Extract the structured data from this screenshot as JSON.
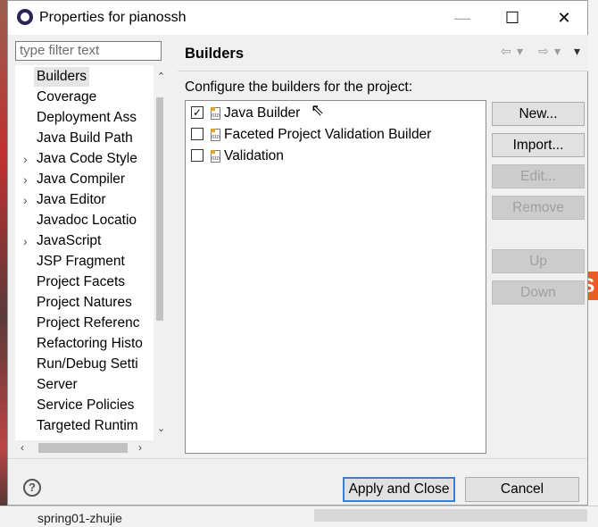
{
  "window": {
    "title": "Properties for pianossh"
  },
  "filter": {
    "placeholder": "type filter text"
  },
  "tree": {
    "items": [
      {
        "label": "Builders",
        "expandable": false,
        "selected": true
      },
      {
        "label": "Coverage",
        "expandable": false
      },
      {
        "label": "Deployment Ass",
        "expandable": false
      },
      {
        "label": "Java Build Path",
        "expandable": false
      },
      {
        "label": "Java Code Style",
        "expandable": true
      },
      {
        "label": "Java Compiler",
        "expandable": true
      },
      {
        "label": "Java Editor",
        "expandable": true
      },
      {
        "label": "Javadoc Locatio",
        "expandable": false
      },
      {
        "label": "JavaScript",
        "expandable": true
      },
      {
        "label": "JSP Fragment",
        "expandable": false
      },
      {
        "label": "Project Facets",
        "expandable": false
      },
      {
        "label": "Project Natures",
        "expandable": false
      },
      {
        "label": "Project Referenc",
        "expandable": false
      },
      {
        "label": "Refactoring Histo",
        "expandable": false
      },
      {
        "label": "Run/Debug Setti",
        "expandable": false
      },
      {
        "label": "Server",
        "expandable": false
      },
      {
        "label": "Service Policies",
        "expandable": false
      },
      {
        "label": "Targeted Runtim",
        "expandable": false
      }
    ]
  },
  "page": {
    "title": "Builders",
    "description": "Configure the builders for the project:",
    "builders": [
      {
        "label": "Java Builder",
        "checked": true
      },
      {
        "label": "Faceted Project Validation Builder",
        "checked": false
      },
      {
        "label": "Validation",
        "checked": false
      }
    ],
    "buttons": {
      "new": "New...",
      "import": "Import...",
      "edit": "Edit...",
      "remove": "Remove",
      "up": "Up",
      "down": "Down"
    }
  },
  "footer": {
    "apply_close": "Apply and Close",
    "cancel": "Cancel"
  },
  "background": {
    "bottom_text": "spring01-zhujie"
  },
  "colors": {
    "accent": "#3c7fd0",
    "dialog_bg": "#f0f0f0"
  }
}
